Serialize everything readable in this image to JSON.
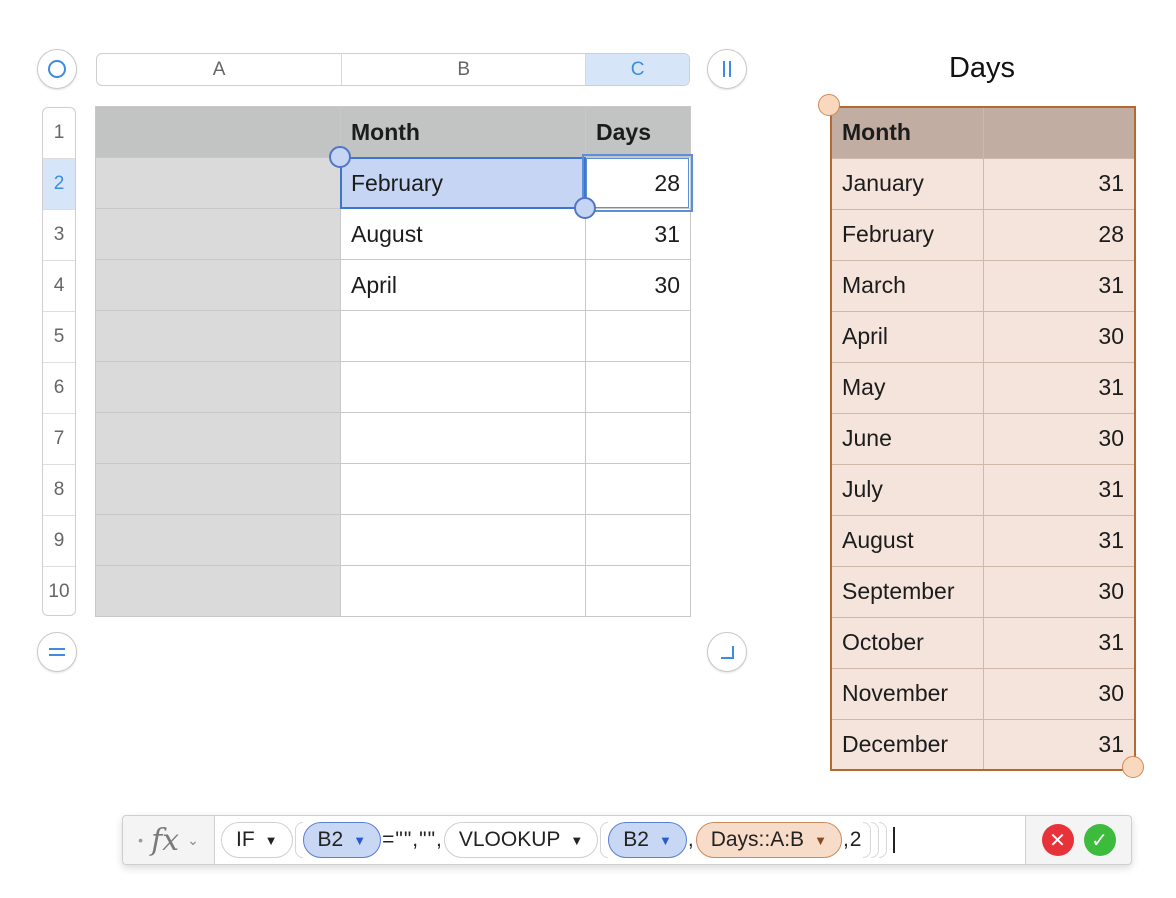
{
  "columns": [
    {
      "label": "A",
      "selected": false
    },
    {
      "label": "B",
      "selected": false
    },
    {
      "label": "C",
      "selected": true
    }
  ],
  "rows": [
    {
      "label": "1",
      "selected": false
    },
    {
      "label": "2",
      "selected": true
    },
    {
      "label": "3",
      "selected": false
    },
    {
      "label": "4",
      "selected": false
    },
    {
      "label": "5",
      "selected": false
    },
    {
      "label": "6",
      "selected": false
    },
    {
      "label": "7",
      "selected": false
    },
    {
      "label": "8",
      "selected": false
    },
    {
      "label": "9",
      "selected": false
    },
    {
      "label": "10",
      "selected": false
    }
  ],
  "main_table": {
    "headers": {
      "a": "",
      "b": "Month",
      "c": "Days"
    },
    "data": [
      {
        "b": "February",
        "c": "28"
      },
      {
        "b": "August",
        "c": "31"
      },
      {
        "b": "April",
        "c": "30"
      },
      {
        "b": "",
        "c": ""
      },
      {
        "b": "",
        "c": ""
      },
      {
        "b": "",
        "c": ""
      },
      {
        "b": "",
        "c": ""
      },
      {
        "b": "",
        "c": ""
      },
      {
        "b": "",
        "c": ""
      }
    ]
  },
  "days_table": {
    "title": "Days",
    "headers": {
      "month": "Month",
      "days": ""
    },
    "data": [
      {
        "month": "January",
        "days": "31"
      },
      {
        "month": "February",
        "days": "28"
      },
      {
        "month": "March",
        "days": "31"
      },
      {
        "month": "April",
        "days": "30"
      },
      {
        "month": "May",
        "days": "31"
      },
      {
        "month": "June",
        "days": "30"
      },
      {
        "month": "July",
        "days": "31"
      },
      {
        "month": "August",
        "days": "31"
      },
      {
        "month": "September",
        "days": "30"
      },
      {
        "month": "October",
        "days": "31"
      },
      {
        "month": "November",
        "days": "30"
      },
      {
        "month": "December",
        "days": "31"
      }
    ]
  },
  "formula_bar": {
    "fx_label": "fx",
    "func_if": "IF",
    "ref1": "B2",
    "lit1": "=\"\",\"\",",
    "func_vlookup": "VLOOKUP",
    "ref2": "B2",
    "sep": ",",
    "ref_range": "Days::A:B",
    "lit2": ",2",
    "cancel_glyph": "✕",
    "accept_glyph": "✓"
  },
  "colors": {
    "selection_blue": "#3f74cf",
    "table_orange": "#b5692e",
    "cancel_red": "#e8323a",
    "accept_green": "#3dbb3d"
  }
}
